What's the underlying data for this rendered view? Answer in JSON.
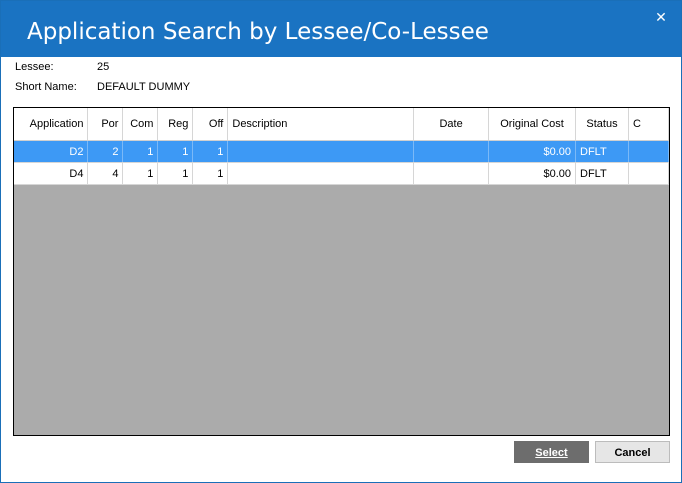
{
  "window": {
    "title": "Application Search by Lessee/Co-Lessee",
    "close_glyph": "✕"
  },
  "info": {
    "lessee_label": "Lessee:",
    "lessee_value": "25",
    "short_name_label": "Short Name:",
    "short_name_value": "DEFAULT DUMMY"
  },
  "grid": {
    "columns": [
      "Application",
      "Por",
      "Com",
      "Reg",
      "Off",
      "Description",
      "Date",
      "Original Cost",
      "Status",
      "C"
    ],
    "rows": [
      {
        "application": "D2",
        "por": "2",
        "com": "1",
        "reg": "1",
        "off": "1",
        "description": "",
        "date": "",
        "original_cost": "$0.00",
        "status": "DFLT",
        "c": "",
        "selected": true
      },
      {
        "application": "D4",
        "por": "4",
        "com": "1",
        "reg": "1",
        "off": "1",
        "description": "",
        "date": "",
        "original_cost": "$0.00",
        "status": "DFLT",
        "c": "",
        "selected": false
      }
    ]
  },
  "buttons": {
    "select_label": "Select",
    "cancel_label": "Cancel"
  },
  "colors": {
    "titlebar": "#1a73c2",
    "selection": "#3d99f5",
    "grid_empty": "#ababab"
  }
}
